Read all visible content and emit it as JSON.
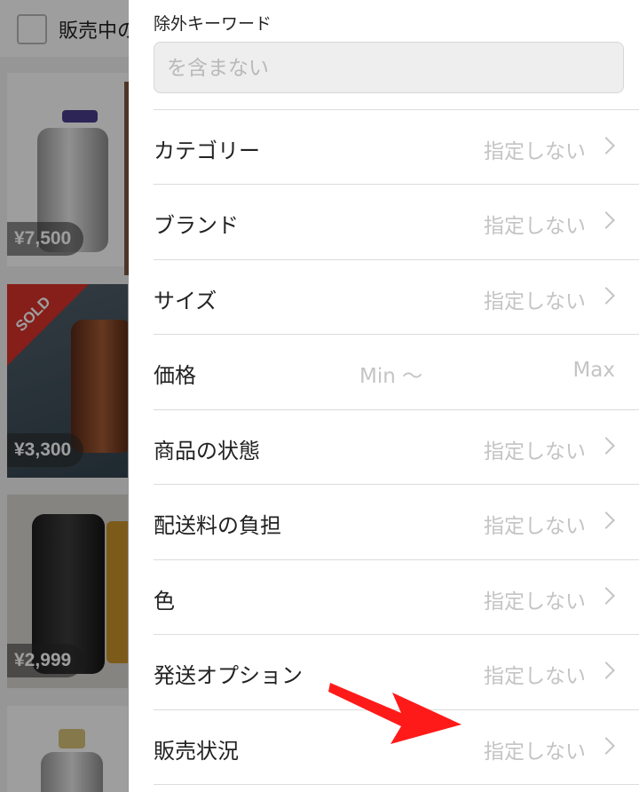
{
  "background": {
    "filter_label": "販売中の",
    "cards": [
      {
        "price": "¥7,500",
        "sold": false
      },
      {
        "price": "¥3,300",
        "sold": true,
        "sold_label": "SOLD"
      },
      {
        "price": "¥2,999",
        "sold": false
      },
      {
        "price": "",
        "sold": false
      }
    ]
  },
  "panel": {
    "exclude_keyword": {
      "label": "除外キーワード",
      "placeholder": "を含まない",
      "value": ""
    },
    "rows": [
      {
        "label": "カテゴリー",
        "value": "指定しない"
      },
      {
        "label": "ブランド",
        "value": "指定しない"
      },
      {
        "label": "サイズ",
        "value": "指定しない"
      },
      {
        "label": "価格",
        "min": "Min 〜",
        "max": "Max"
      },
      {
        "label": "商品の状態",
        "value": "指定しない"
      },
      {
        "label": "配送料の負担",
        "value": "指定しない"
      },
      {
        "label": "色",
        "value": "指定しない"
      },
      {
        "label": "発送オプション",
        "value": "指定しない"
      },
      {
        "label": "販売状況",
        "value": "指定しない"
      }
    ]
  },
  "colors": {
    "annotation_arrow": "#ff1a1a",
    "sold_badge": "#d9312b",
    "muted_text": "#c4c4c4"
  }
}
